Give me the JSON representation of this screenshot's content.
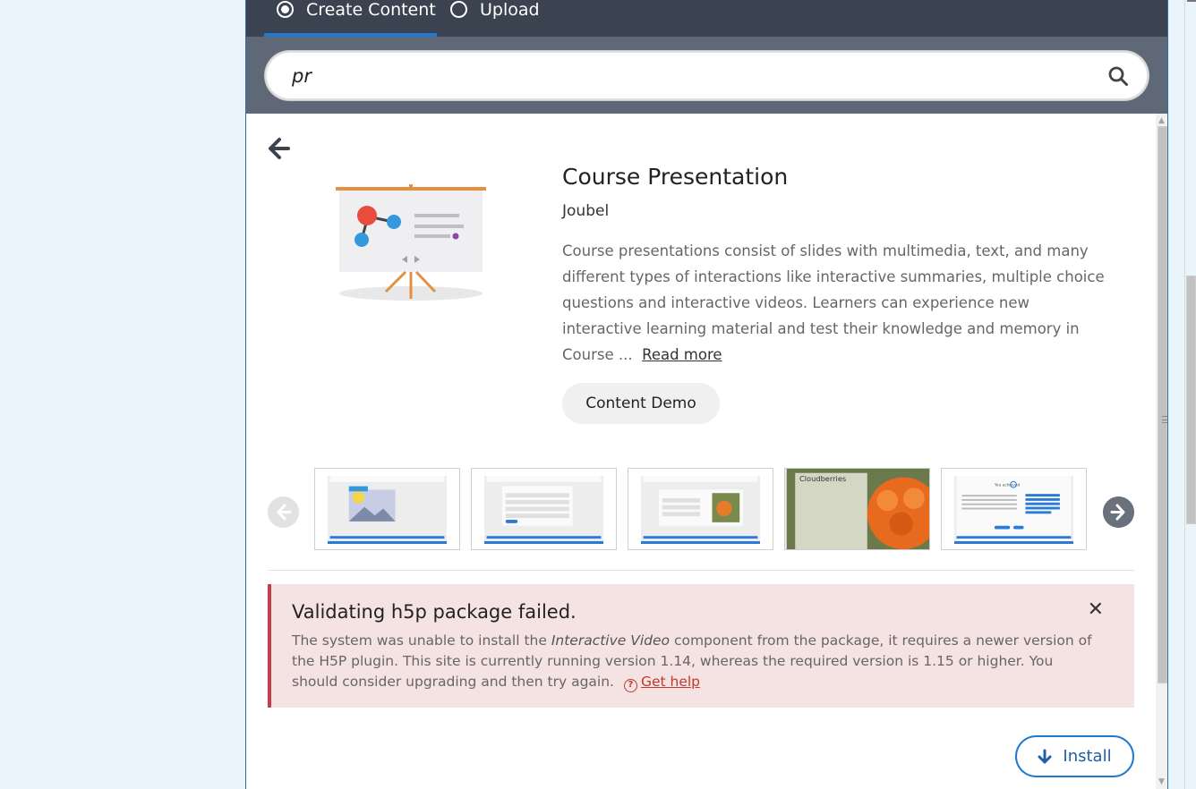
{
  "tabs": [
    {
      "label": "Create Content",
      "selected": true
    },
    {
      "label": "Upload",
      "selected": false
    }
  ],
  "search": {
    "value": "pr",
    "icon": "search-icon"
  },
  "content": {
    "title": "Course Presentation",
    "owner": "Joubel",
    "description": "Course presentations consist of slides with multimedia, text, and many different types of interactions like interactive summaries, multiple choice questions and interactive videos. Learners can experience new interactive learning material and test their knowledge and memory in Course ...",
    "read_more": "Read more",
    "demo_button": "Content Demo"
  },
  "screenshots": [
    {
      "name": "screenshot-image-slide"
    },
    {
      "name": "screenshot-question-slide"
    },
    {
      "name": "screenshot-image-question-slide"
    },
    {
      "name": "screenshot-cloudberries-slide",
      "caption": "Cloudberries"
    },
    {
      "name": "screenshot-summary-slide",
      "caption": "You achieved"
    }
  ],
  "alert": {
    "title": "Validating h5p package failed.",
    "message_before": "The system was unable to install the ",
    "message_component": "Interactive Video",
    "message_after": " component from the package, it requires a newer version of the H5P plugin. This site is currently running version 1.14, whereas the required version is 1.15 or higher. You should consider upgrading and then try again.",
    "help_label": "Get help"
  },
  "install_button": "Install",
  "colors": {
    "accent": "#1f78d1",
    "topbar": "#3b4350",
    "search_bar": "#5e6877",
    "alert_bg": "#f5e2e3",
    "alert_border": "#c73b4a",
    "help_link": "#c0392b"
  }
}
